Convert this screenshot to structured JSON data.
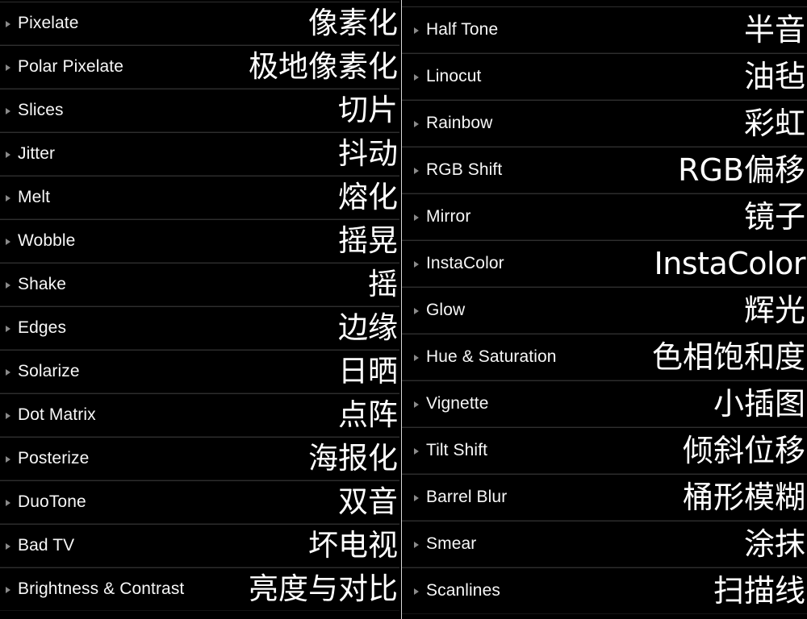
{
  "app": {
    "background_color": "#000000",
    "text_color": "#ffffff",
    "separator_color": "#2e2e2e",
    "divider_color": "#d9d9d9",
    "disclosure_color": "#8a8a8a"
  },
  "columns": [
    {
      "name": "left-column",
      "items": [
        {
          "en": "Pixelate",
          "zh": "像素化"
        },
        {
          "en": "Polar Pixelate",
          "zh": "极地像素化"
        },
        {
          "en": "Slices",
          "zh": "切片"
        },
        {
          "en": "Jitter",
          "zh": "抖动"
        },
        {
          "en": "Melt",
          "zh": "熔化"
        },
        {
          "en": "Wobble",
          "zh": "摇晃"
        },
        {
          "en": "Shake",
          "zh": "摇"
        },
        {
          "en": "Edges",
          "zh": "边缘"
        },
        {
          "en": "Solarize",
          "zh": "日晒"
        },
        {
          "en": "Dot Matrix",
          "zh": "点阵"
        },
        {
          "en": "Posterize",
          "zh": "海报化"
        },
        {
          "en": "DuoTone",
          "zh": "双音"
        },
        {
          "en": "Bad TV",
          "zh": "坏电视"
        },
        {
          "en": "Brightness & Contrast",
          "zh": "亮度与对比"
        }
      ]
    },
    {
      "name": "right-column",
      "items": [
        {
          "en": "Half Tone",
          "zh": "半音"
        },
        {
          "en": "Linocut",
          "zh": "油毡"
        },
        {
          "en": "Rainbow",
          "zh": "彩虹"
        },
        {
          "en": "RGB Shift",
          "zh": "RGB偏移"
        },
        {
          "en": "Mirror",
          "zh": "镜子"
        },
        {
          "en": "InstaColor",
          "zh": "InstaColor",
          "latin": true
        },
        {
          "en": "Glow",
          "zh": "辉光"
        },
        {
          "en": "Hue & Saturation",
          "zh": "色相饱和度"
        },
        {
          "en": "Vignette",
          "zh": "小插图"
        },
        {
          "en": "Tilt Shift",
          "zh": "倾斜位移"
        },
        {
          "en": "Barrel Blur",
          "zh": "桶形模糊"
        },
        {
          "en": "Smear",
          "zh": "涂抹"
        },
        {
          "en": "Scanlines",
          "zh": "扫描线"
        }
      ]
    }
  ]
}
